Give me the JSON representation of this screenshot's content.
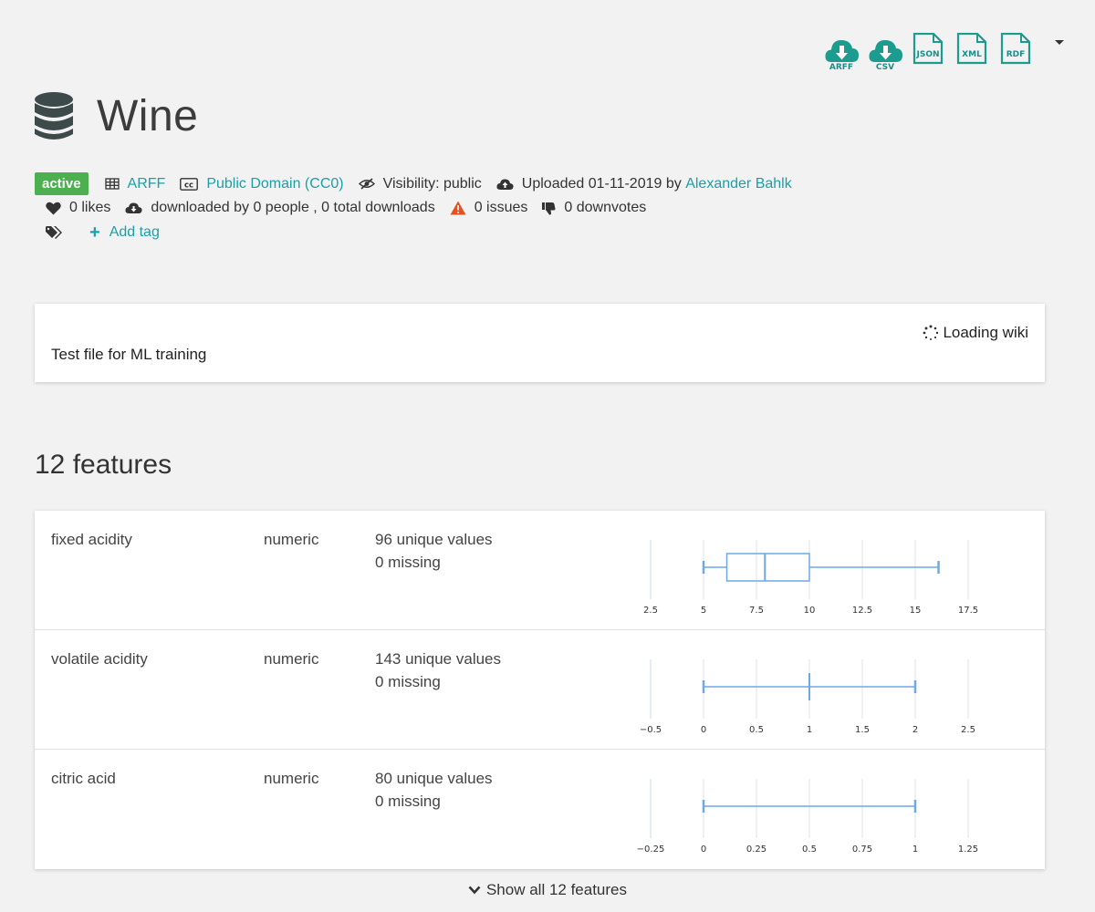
{
  "downloads": [
    {
      "label": "ARFF",
      "icon": "cloud-download-icon",
      "kind": "cloud"
    },
    {
      "label": "CSV",
      "icon": "cloud-download-icon",
      "kind": "cloud"
    },
    {
      "label": "JSON",
      "icon": "file-icon",
      "kind": "doc"
    },
    {
      "label": "XML",
      "icon": "file-icon",
      "kind": "doc"
    },
    {
      "label": "RDF",
      "icon": "file-icon",
      "kind": "doc"
    }
  ],
  "dataset": {
    "title": "Wine",
    "status": "active",
    "format": "ARFF",
    "license": "Public Domain (CC0)",
    "visibility": "Visibility: public",
    "uploaded": "Uploaded 01-11-2019 by",
    "uploader": "Alexander Bahlk",
    "likes": "0 likes",
    "downloads_text": "downloaded by 0 people , 0 total downloads",
    "issues": "0 issues",
    "downvotes": "0 downvotes",
    "add_tag": "Add tag"
  },
  "wiki": {
    "loading": "Loading wiki",
    "description": "Test file for ML training"
  },
  "features_heading": "12 features",
  "features": [
    {
      "name": "fixed acidity",
      "type": "numeric",
      "unique": "96 unique values",
      "missing": "0 missing",
      "ticks": [
        "2.5",
        "5",
        "7.5",
        "10",
        "12.5",
        "15",
        "17.5"
      ],
      "tick_values": [
        2.5,
        5,
        7.5,
        10,
        12.5,
        15,
        17.5
      ],
      "box": {
        "min": 5,
        "q1": 6.1,
        "median": 7.9,
        "q3": 10,
        "max": 16.1
      }
    },
    {
      "name": "volatile acidity",
      "type": "numeric",
      "unique": "143 unique values",
      "missing": "0 missing",
      "ticks": [
        "−0.5",
        "0",
        "0.5",
        "1",
        "1.5",
        "2",
        "2.5"
      ],
      "tick_values": [
        -0.5,
        0,
        0.5,
        1,
        1.5,
        2,
        2.5
      ],
      "box": {
        "min": 0,
        "q1": 1,
        "median": 1,
        "q3": 1,
        "max": 2
      }
    },
    {
      "name": "citric acid",
      "type": "numeric",
      "unique": "80 unique values",
      "missing": "0 missing",
      "ticks": [
        "−0.25",
        "0",
        "0.25",
        "0.5",
        "0.75",
        "1",
        "1.25"
      ],
      "tick_values": [
        -0.25,
        0,
        0.25,
        0.5,
        0.75,
        1,
        1.25
      ],
      "box": {
        "min": 0,
        "q1": 0,
        "median": 0,
        "q3": 0,
        "max": 1
      }
    }
  ],
  "show_all": "Show all 12 features",
  "colors": {
    "accent": "#1aa0a7",
    "badge": "#4caf50",
    "box": "#6ea8e8",
    "warning": "#e8501f",
    "icon_teal": "#1a9c8f"
  }
}
